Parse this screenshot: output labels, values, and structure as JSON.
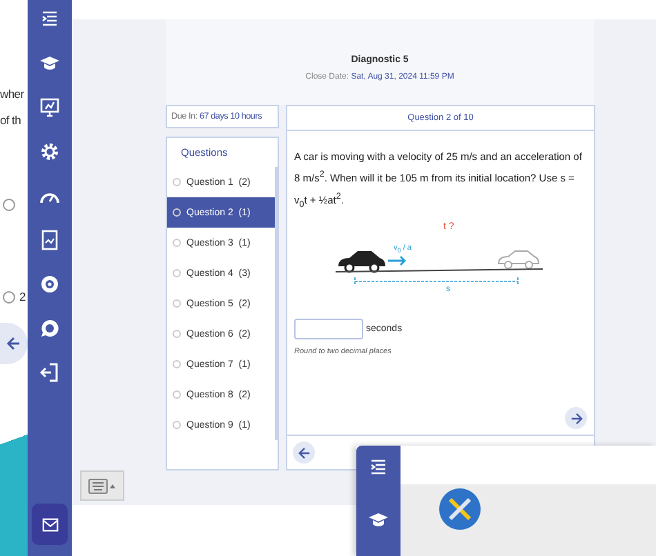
{
  "background_window": {
    "text_lines": [
      "wher",
      "of th"
    ],
    "options": [
      {
        "selected": false
      },
      {
        "label": "2",
        "selected": false
      }
    ]
  },
  "header": {
    "title": "Diagnostic 5",
    "close_date_label": "Close Date:",
    "close_date_value": "Sat, Aug 31, 2024 11:59 PM"
  },
  "due": {
    "label": "Due In:",
    "value": "67 days 10 hours"
  },
  "questions": {
    "heading": "Questions",
    "items": [
      {
        "label": "Question 1",
        "points": "(2)",
        "selected": false
      },
      {
        "label": "Question 2",
        "points": "(1)",
        "selected": true
      },
      {
        "label": "Question 3",
        "points": "(1)",
        "selected": false
      },
      {
        "label": "Question 4",
        "points": "(3)",
        "selected": false
      },
      {
        "label": "Question 5",
        "points": "(2)",
        "selected": false
      },
      {
        "label": "Question 6",
        "points": "(2)",
        "selected": false
      },
      {
        "label": "Question 7",
        "points": "(1)",
        "selected": false
      },
      {
        "label": "Question 8",
        "points": "(2)",
        "selected": false
      },
      {
        "label": "Question 9",
        "points": "(1)",
        "selected": false
      }
    ]
  },
  "question": {
    "header": "Question 2 of 10",
    "text": "A car is moving with a velocity of 25 m/s and an acceleration of 8 m/s$^{2}$. When will it be 105 m from its initial location? Use s = v$_{0}$t + ½at$^{2}$.",
    "diagram": {
      "unknown": "t ?",
      "velocity": "v$_{0}$ / a",
      "distance": "s"
    },
    "answer": {
      "unit": "seconds",
      "hint": "Round to two decimal places"
    }
  }
}
